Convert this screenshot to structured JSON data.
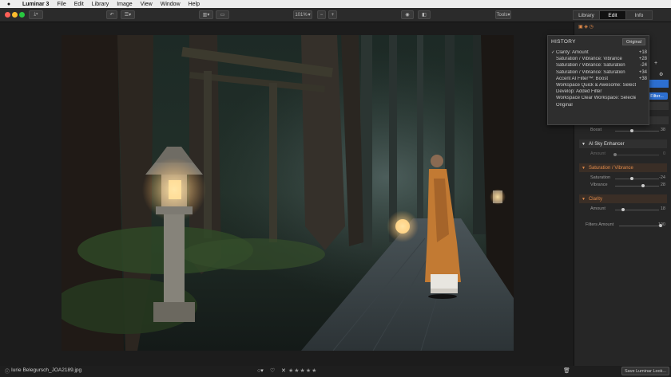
{
  "menubar": {
    "app": "Luminar 3",
    "items": [
      "File",
      "Edit",
      "Library",
      "Image",
      "View",
      "Window",
      "Help"
    ]
  },
  "toolbar": {
    "zoom": "101%",
    "tools_label": "Tools",
    "tabs": [
      {
        "label": "Library"
      },
      {
        "label": "Edit"
      },
      {
        "label": "Info"
      }
    ]
  },
  "history": {
    "title": "HISTORY",
    "original_button": "Original",
    "entries": [
      {
        "label": "Clarity: Amount",
        "value": "+18",
        "checked": true
      },
      {
        "label": "Saturation / Vibrance: Vibrance",
        "value": "+28"
      },
      {
        "label": "Saturation / Vibrance: Saturation",
        "value": "-24"
      },
      {
        "label": "Saturation / Vibrance: Saturation",
        "value": "+34"
      },
      {
        "label": "Accent AI Filter™: Boost",
        "value": "+38"
      },
      {
        "label": "Workspace Quick & Awesome: Select...",
        "value": ""
      },
      {
        "label": "Develop: Added Filter",
        "value": ""
      },
      {
        "label": "Workspace Clear Workspace: Selected",
        "value": ""
      },
      {
        "label": "Original",
        "value": ""
      }
    ]
  },
  "panel": {
    "filter_btn": "Filter...",
    "boost": {
      "label": "Boost",
      "value": "38",
      "fraction": 0.38
    },
    "sky": {
      "title": "AI Sky Enhancer",
      "amount_label": "Amount",
      "amount_value": "0",
      "fraction": 0.0
    },
    "satvib": {
      "title": "Saturation / Vibrance",
      "saturation_label": "Saturation",
      "saturation_value": "-24",
      "saturation_fraction": 0.38,
      "vibrance_label": "Vibrance",
      "vibrance_value": "28",
      "vibrance_fraction": 0.64
    },
    "clarity": {
      "title": "Clarity",
      "amount_label": "Amount",
      "amount_value": "18",
      "fraction": 0.18
    },
    "filters_amount": {
      "label": "Filters Amount",
      "value": "100",
      "fraction": 1.0
    }
  },
  "status": {
    "filename": "Iurie Belegursch_JOA2189.jpg",
    "save_look": "Save Luminar Look..."
  },
  "colors": {
    "accent_blue": "#2d6fd0",
    "section_orange": "#e08a4a"
  }
}
